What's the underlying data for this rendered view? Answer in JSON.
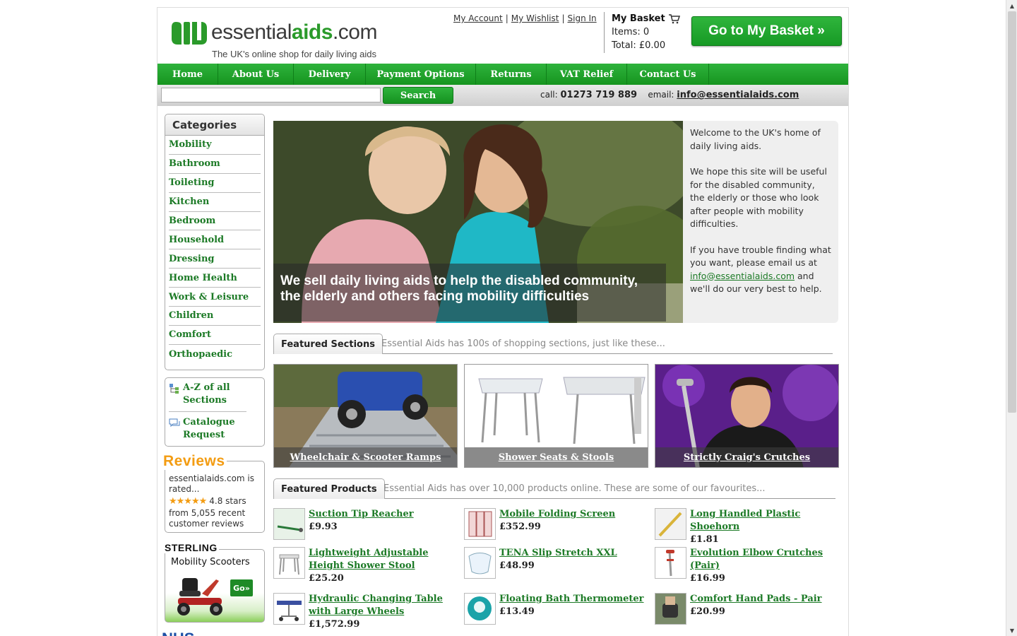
{
  "header": {
    "brand_prefix": "essential",
    "brand_bold": "aids",
    "brand_suffix": ".com",
    "tagline": "The UK's online shop for daily living aids",
    "links": [
      "My Account",
      "My Wishlist",
      "Sign In"
    ],
    "basket_title": "My Basket",
    "basket_items": "Items: 0",
    "basket_total": "Total: £0.00",
    "go_basket": "Go to My Basket »"
  },
  "nav": [
    "Home",
    "About Us",
    "Delivery",
    "Payment Options",
    "Returns",
    "VAT Relief",
    "Contact Us"
  ],
  "search": {
    "button": "Search",
    "call_label": "call:",
    "phone": "01273 719 889",
    "email_label": "email:",
    "email": "info@essentialaids.com"
  },
  "sidebar": {
    "title": "Categories",
    "categories": [
      "Mobility",
      "Bathroom",
      "Toileting",
      "Kitchen",
      "Bedroom",
      "Household",
      "Dressing",
      "Home Health",
      "Work & Leisure",
      "Children",
      "Comfort",
      "Orthopaedic"
    ],
    "az": "A-Z of all Sections",
    "catalogue": "Catalogue Request",
    "reviews_title": "Reviews",
    "reviews_line1": "essentialaids.com is rated...",
    "reviews_stars": "★★★★★",
    "reviews_rating": "4.8 stars",
    "reviews_line2": "from 5,055 recent customer reviews",
    "sterling_title": "STERLING",
    "sterling_sub": "Mobility Scooters",
    "sterling_go": "Go»",
    "nhs": "NHS"
  },
  "hero": {
    "caption": "We sell daily living aids to help the disabled community, the elderly and others facing mobility difficulties"
  },
  "welcome": {
    "p1": "Welcome to the UK's home of daily living aids.",
    "p2": "We hope this site will be useful for the disabled community, the elderly or those who look after people with mobility difficulties.",
    "p3_a": "If you have trouble finding what you want, please email us at",
    "p3_link": "info@essentialaids.com",
    "p3_b": "and we'll do our very best to help."
  },
  "featured_sections": {
    "tab": "Featured Sections",
    "desc": "Essential Aids has 100s of shopping sections, just like these...",
    "items": [
      "Wheelchair & Scooter Ramps",
      "Shower Seats & Stools",
      "Strictly Craig's Crutches"
    ]
  },
  "featured_products": {
    "tab": "Featured Products",
    "desc": "Essential Aids has over 10,000 products online. These are some of our favourites...",
    "items": [
      {
        "name": "Suction Tip Reacher",
        "price": "£9.93"
      },
      {
        "name": "Mobile Folding Screen",
        "price": "£352.99"
      },
      {
        "name": "Long Handled Plastic Shoehorn",
        "price": "£1.81"
      },
      {
        "name": "Lightweight Adjustable Height Shower Stool",
        "price": "£25.20"
      },
      {
        "name": "TENA Slip Stretch XXL",
        "price": "£48.99"
      },
      {
        "name": "Evolution Elbow Crutches (Pair)",
        "price": "£16.99"
      },
      {
        "name": "Hydraulic Changing Table with Large Wheels",
        "price": "£1,572.99"
      },
      {
        "name": "Floating Bath Thermometer",
        "price": "£13.49"
      },
      {
        "name": "Comfort Hand Pads - Pair",
        "price": "£20.99"
      }
    ]
  },
  "colors": {
    "brand_green": "#1c7a26",
    "nav_green": "#2eb33c",
    "reviews_orange": "#f39c12"
  }
}
